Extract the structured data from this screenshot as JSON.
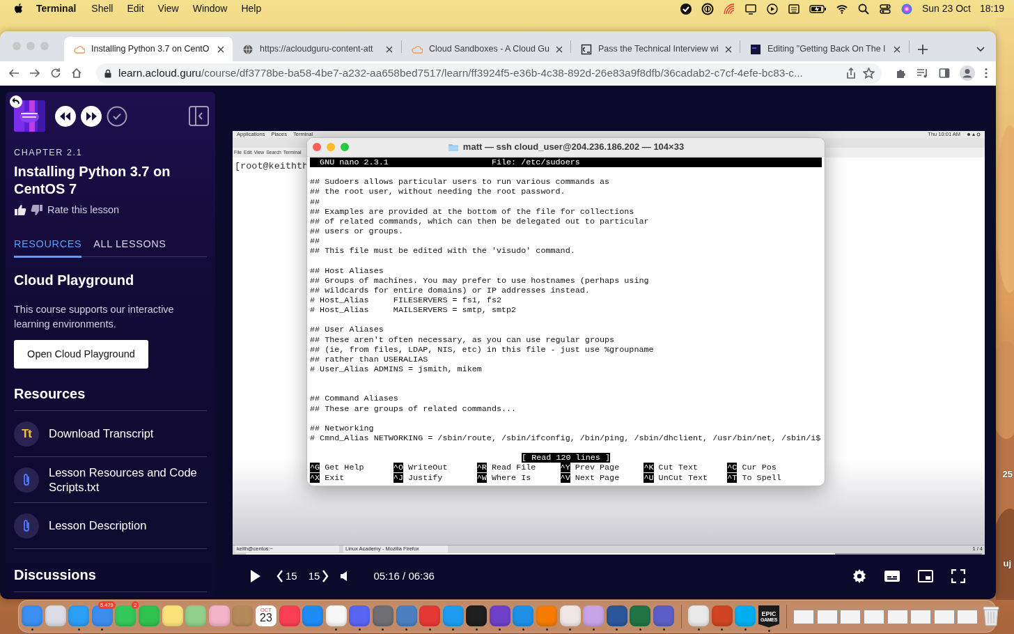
{
  "menu_bar": {
    "app": "Terminal",
    "menus": [
      "Shell",
      "Edit",
      "View",
      "Window",
      "Help"
    ],
    "date": "Sun 23 Oct",
    "time": "18:19"
  },
  "browser": {
    "tabs": [
      {
        "kind": "cloud",
        "title": "Installing Python 3.7 on CentO",
        "selected": true
      },
      {
        "kind": "globe",
        "title": "https://acloudguru-content-att",
        "selected": false
      },
      {
        "kind": "cloud",
        "title": "Cloud Sandboxes - A Cloud Gu",
        "selected": false
      },
      {
        "kind": "code",
        "title": "Pass the Technical Interview wi",
        "selected": false
      },
      {
        "kind": "dark",
        "title": "Editing \"Getting Back On The I",
        "selected": false
      }
    ],
    "url_host": "learn.acloud.guru",
    "url_path": "/course/df3778be-ba58-4be7-a232-aa658bed7517/learn/ff3924f5-e36b-4c38-892d-26e83a9f8dfb/36cadab2-c7cf-4efe-bc83-c..."
  },
  "sidebar": {
    "chapter": "CHAPTER 2.1",
    "title": "Installing Python 3.7 on CentOS 7",
    "rate": "Rate this lesson",
    "tabs": [
      {
        "label": "RESOURCES",
        "selected": true
      },
      {
        "label": "ALL LESSONS",
        "selected": false
      }
    ],
    "playground": {
      "heading": "Cloud Playground",
      "description": "This course supports our interactive learning environments.",
      "button": "Open Cloud Playground"
    },
    "resources": {
      "heading": "Resources",
      "items": [
        {
          "kind": "transcript",
          "icon_text": "Tt",
          "label": "Download Transcript"
        },
        {
          "kind": "attachment",
          "label": "Lesson Resources and Code Scripts.txt"
        },
        {
          "kind": "attachment",
          "label": "Lesson Description"
        }
      ]
    },
    "discussions": "Discussions"
  },
  "video": {
    "desktop_bar": {
      "menus": [
        "Applications",
        "Places",
        "Terminal"
      ],
      "clock": "Thu 10:01 AM"
    },
    "window_menu": [
      "File",
      "Edit",
      "View",
      "Search",
      "Terminal"
    ],
    "prompt": "[root@keithth",
    "taskbar": [
      "keith@centos:~",
      "Linux Academy - Mozilla Firefox"
    ],
    "workspace": "1 / 4",
    "terminal": {
      "title": "matt — ssh cloud_user@204.236.186.202 — 104×33",
      "nano": {
        "version": "GNU nano 2.3.1",
        "file": "File: /etc/sudoers",
        "lines": [
          {
            "kind": "text",
            "text": "## Sudoers allows particular users to run various commands as"
          },
          {
            "kind": "text",
            "text": "## the root user, without needing the root password."
          },
          {
            "kind": "text",
            "text": "##"
          },
          {
            "kind": "text",
            "text": "## Examples are provided at the bottom of the file for collections"
          },
          {
            "kind": "text",
            "text": "## of related commands, which can then be delegated out to particular"
          },
          {
            "kind": "text",
            "text": "## users or groups."
          },
          {
            "kind": "text",
            "text": "##"
          },
          {
            "kind": "text",
            "text": "## This file must be edited with the 'visudo' command."
          },
          {
            "kind": "blank"
          },
          {
            "kind": "text",
            "text": "## Host Aliases"
          },
          {
            "kind": "text",
            "text": "## Groups of machines. You may prefer to use hostnames (perhaps using"
          },
          {
            "kind": "text",
            "text": "## wildcards for entire domains) or IP addresses instead."
          },
          {
            "kind": "text",
            "text": "# Host_Alias     FILESERVERS = fs1, fs2"
          },
          {
            "kind": "text",
            "text": "# Host_Alias     MAILSERVERS = smtp, smtp2"
          },
          {
            "kind": "blank"
          },
          {
            "kind": "text",
            "text": "## User Aliases"
          },
          {
            "kind": "text",
            "text": "## These aren't often necessary, as you can use regular groups"
          },
          {
            "kind": "text",
            "text": "## (ie, from files, LDAP, NIS, etc) in this file - just use %groupname"
          },
          {
            "kind": "text",
            "text": "## rather than USERALIAS"
          },
          {
            "kind": "text",
            "text": "# User_Alias ADMINS = jsmith, mikem"
          },
          {
            "kind": "blank"
          },
          {
            "kind": "blank"
          },
          {
            "kind": "text",
            "text": "## Command Aliases"
          },
          {
            "kind": "text",
            "text": "## These are groups of related commands..."
          },
          {
            "kind": "blank"
          },
          {
            "kind": "text",
            "text": "## Networking"
          },
          {
            "kind": "text",
            "text": "# Cmnd_Alias NETWORKING = /sbin/route, /sbin/ifconfig, /bin/ping, /sbin/dhclient, /usr/bin/net, /sbin/i$"
          }
        ],
        "status": "[ Read 120 lines ]",
        "shortcuts": [
          {
            "key": "^G",
            "label": "Get Help"
          },
          {
            "key": "^X",
            "label": "Exit"
          },
          {
            "key": "^O",
            "label": "WriteOut"
          },
          {
            "key": "^J",
            "label": "Justify"
          },
          {
            "key": "^R",
            "label": "Read File"
          },
          {
            "key": "^W",
            "label": "Where Is"
          },
          {
            "key": "^Y",
            "label": "Prev Page"
          },
          {
            "key": "^V",
            "label": "Next Page"
          },
          {
            "key": "^K",
            "label": "Cut Text"
          },
          {
            "key": "^U",
            "label": "UnCut Text"
          },
          {
            "key": "^C",
            "label": "Cur Pos"
          },
          {
            "key": "^T",
            "label": "To Spell"
          }
        ]
      }
    },
    "player": {
      "level": 0.8,
      "skip_back": "15",
      "skip_forward": "15",
      "time": "05:16 / 06:36"
    }
  },
  "desktop_labels": [
    "25",
    "uj"
  ],
  "dock": [
    {
      "kind": "app",
      "color": "#3b8ff0",
      "running": true
    },
    {
      "kind": "app",
      "color": "#dcdce6",
      "running": false
    },
    {
      "kind": "app",
      "color": "#2a9df4",
      "running": true
    },
    {
      "kind": "app",
      "color": "#3d8cf0",
      "running": true,
      "badge": "5,479"
    },
    {
      "kind": "app",
      "color": "#34c759",
      "running": false,
      "badge": "2"
    },
    {
      "kind": "app",
      "color": "#30c24f",
      "running": false
    },
    {
      "kind": "app",
      "color": "#fbe37a",
      "running": false
    },
    {
      "kind": "app",
      "color": "#8fd18a",
      "running": false
    },
    {
      "kind": "app",
      "color": "#f3b3c9",
      "running": false
    },
    {
      "kind": "app",
      "color": "#b58a5a",
      "running": false
    },
    {
      "kind": "calendar",
      "month": "OCT",
      "day": "23",
      "running": false
    },
    {
      "kind": "app",
      "color": "#fa3e55",
      "running": false
    },
    {
      "kind": "app",
      "color": "#1f8cf5",
      "running": false
    },
    {
      "kind": "app",
      "color": "#f7f7f7",
      "running": true
    },
    {
      "kind": "app",
      "color": "#5865f2",
      "running": true
    },
    {
      "kind": "app",
      "color": "#6e6e73",
      "running": true
    },
    {
      "kind": "app",
      "color": "#4a7fc1",
      "running": true
    },
    {
      "kind": "app",
      "color": "#e53935",
      "running": true
    },
    {
      "kind": "app",
      "color": "#1f9cf0",
      "running": true
    },
    {
      "kind": "app",
      "color": "#1e1e1e",
      "running": true
    },
    {
      "kind": "app",
      "color": "#6e40c9",
      "running": true
    },
    {
      "kind": "app",
      "color": "#1d91e6",
      "running": true
    },
    {
      "kind": "app",
      "color": "#f57c00",
      "running": true
    },
    {
      "kind": "app",
      "color": "#f0e6e6",
      "running": true
    },
    {
      "kind": "app",
      "color": "#c7a3e8",
      "running": true
    },
    {
      "kind": "app",
      "color": "#2b579a",
      "running": true
    },
    {
      "kind": "app",
      "color": "#217346",
      "running": true
    },
    {
      "kind": "app",
      "color": "#5b5fc7",
      "running": true
    },
    {
      "kind": "divider"
    },
    {
      "kind": "app",
      "color": "#e9e9e9",
      "running": true
    },
    {
      "kind": "app",
      "color": "#d04423",
      "running": true
    },
    {
      "kind": "app",
      "color": "#00aff0",
      "running": true
    },
    {
      "kind": "epic",
      "line1": "EPIC",
      "line2": "GAMES",
      "running": true
    },
    {
      "kind": "divider"
    },
    {
      "kind": "window"
    },
    {
      "kind": "window"
    },
    {
      "kind": "window"
    },
    {
      "kind": "window"
    },
    {
      "kind": "window"
    },
    {
      "kind": "window"
    },
    {
      "kind": "window"
    },
    {
      "kind": "window"
    },
    {
      "kind": "trash"
    }
  ]
}
